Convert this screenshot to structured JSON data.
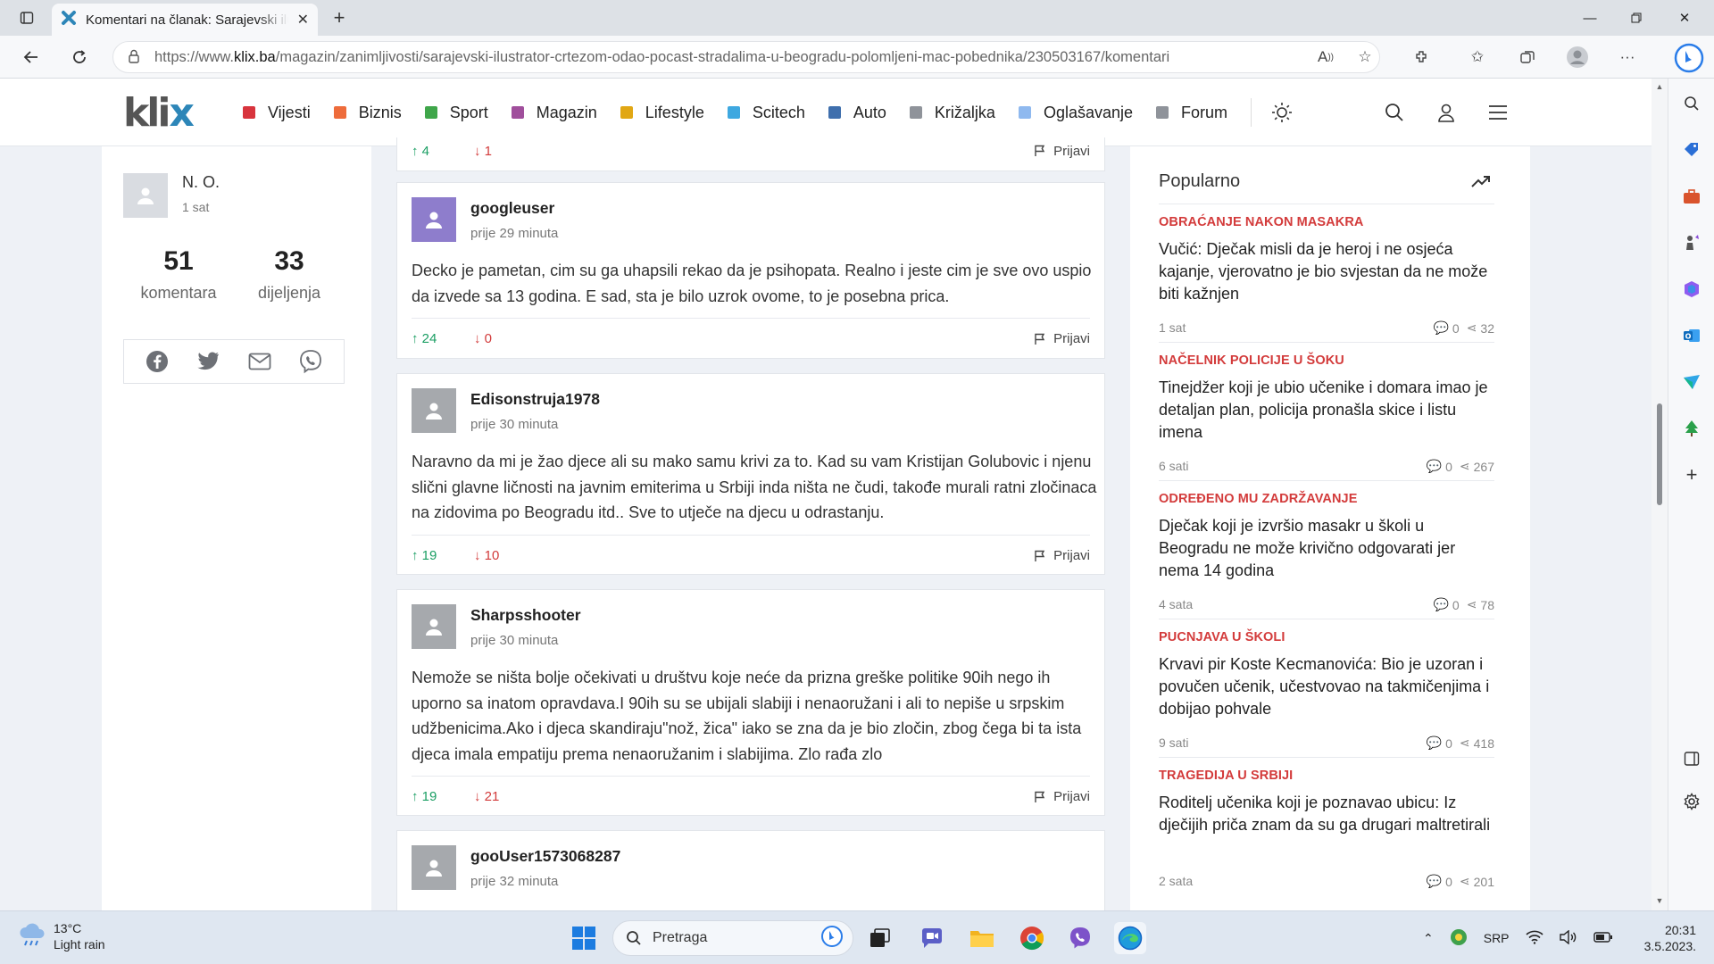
{
  "browser": {
    "tab_title": "Komentari na članak: Sarajevski ilustrator",
    "url_prefix": "https://www.",
    "url_host": "klix.ba",
    "url_path": "/magazin/zanimljivosti/sarajevski-ilustrator-crtezom-odao-pocast-stradalima-u-beogradu-polomljeni-mac-pobednika/230503167/komentari"
  },
  "site": {
    "logo": "kli",
    "logo_x": "x",
    "nav": [
      {
        "label": "Vijesti",
        "color": "#d8343d"
      },
      {
        "label": "Biznis",
        "color": "#ee6c3b"
      },
      {
        "label": "Sport",
        "color": "#3fa64a"
      },
      {
        "label": "Magazin",
        "color": "#a04f9c"
      },
      {
        "label": "Lifestyle",
        "color": "#e1a714"
      },
      {
        "label": "Scitech",
        "color": "#3ea8e0"
      },
      {
        "label": "Auto",
        "color": "#3f6fad"
      },
      {
        "label": "Križaljka",
        "color": "#8f939a"
      },
      {
        "label": "Oglašavanje",
        "color": "#8fb9ef"
      },
      {
        "label": "Forum",
        "color": "#8f939a"
      }
    ]
  },
  "article_meta": {
    "author": "N. O.",
    "time": "1 sat",
    "comments_count": "51",
    "comments_label": "komentara",
    "shares_count": "33",
    "shares_label": "dijeljenja"
  },
  "comments": [
    {
      "up": "4",
      "down": "1",
      "report": "Prijavi"
    },
    {
      "user": "googleuser",
      "time": "prije 29 minuta",
      "text": "Decko je pametan, cim su ga uhapsili rekao da je psihopata. Realno i jeste cim je sve ovo uspio da izvede sa 13 godina. E sad, sta je bilo uzrok ovome, to je posebna prica.",
      "up": "24",
      "down": "0",
      "report": "Prijavi"
    },
    {
      "user": "Edisonstruja1978",
      "time": "prije 30 minuta",
      "text": "Naravno da mi je žao djece ali su mako samu krivi za to. Kad su vam Kristijan Golubovic i njenu slični glavne ličnosti na javnim emiterima u Srbiji inda ništa ne čudi, takođe murali ratni zločinaca na zidovima po Beogradu itd.. Sve to utječe na djecu u odrastanju.",
      "up": "19",
      "down": "10",
      "report": "Prijavi"
    },
    {
      "user": "Sharpsshooter",
      "time": "prije 30 minuta",
      "text": "Nemože se ništa bolje očekivati u društvu koje neće da prizna greške politike 90ih nego ih uporno sa inatom opravdava.I 90ih su se ubijali slabiji i nenaoružani i ali to nepiše u srpskim udžbenicima.Ako i djeca skandiraju\"nož, žica\" iako se zna da je bio zločin, zbog čega bi ta ista djeca imala empatiju prema nenaoružanim i slabijima. Zlo rađa zlo",
      "up": "19",
      "down": "21",
      "report": "Prijavi"
    },
    {
      "user": "gooUser1573068287",
      "time": "prije 32 minuta"
    }
  ],
  "popular": {
    "title": "Popularno",
    "items": [
      {
        "kicker": "OBRAĆANJE NAKON MASAKRA",
        "title": "Vučić: Dječak misli da je heroj i ne osjeća kajanje, vjerovatno je bio svjestan da ne može biti kažnjen",
        "time": "1 sat",
        "comments": "0",
        "shares": "32"
      },
      {
        "kicker": "NAČELNIK POLICIJE U ŠOKU",
        "title": "Tinejdžer koji je ubio učenike i domara imao je detaljan plan, policija pronašla skice i listu imena",
        "time": "6 sati",
        "comments": "0",
        "shares": "267"
      },
      {
        "kicker": "ODREĐENO MU ZADRŽAVANJE",
        "title": "Dječak koji je izvršio masakr u školi u Beogradu ne može krivično odgovarati jer nema 14 godina",
        "time": "4 sata",
        "comments": "0",
        "shares": "78"
      },
      {
        "kicker": "PUCNJAVA U ŠKOLI",
        "title": "Krvavi pir Koste Kecmanovića: Bio je uzoran i povučen učenik, učestvovao na takmičenjima i dobijao pohvale",
        "time": "9 sati",
        "comments": "0",
        "shares": "418"
      },
      {
        "kicker": "TRAGEDIJA U SRBIJI",
        "title": "Roditelj učenika koji je poznavao ubicu: Iz dječijih priča znam da su ga drugari maltretirali",
        "time": "2 sata",
        "comments": "0",
        "shares": "201"
      }
    ]
  },
  "taskbar": {
    "temp": "13°C",
    "weather": "Light rain",
    "search_placeholder": "Pretraga",
    "lang": "SRP",
    "time": "20:31",
    "date": "3.5.2023."
  }
}
